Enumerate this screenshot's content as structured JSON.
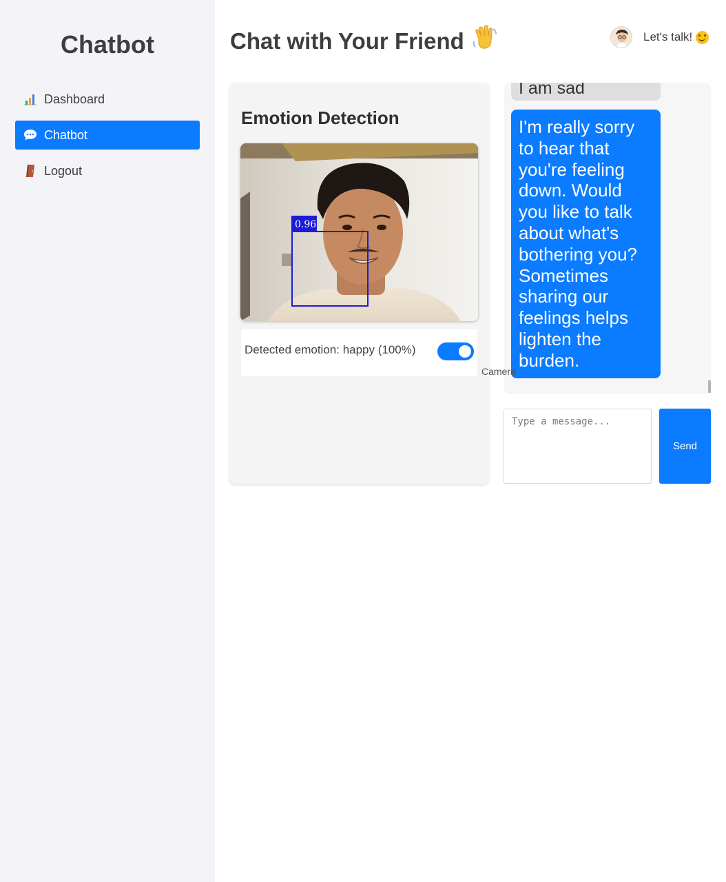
{
  "sidebar": {
    "brand": "Chatbot",
    "items": [
      {
        "label": "Dashboard",
        "icon": "bar-chart-icon"
      },
      {
        "label": "Chatbot",
        "icon": "speech-bubble-icon",
        "active": true
      },
      {
        "label": "Logout",
        "icon": "door-icon"
      }
    ]
  },
  "header": {
    "title": "Chat with Your Friend",
    "title_icon": "waving-hand-icon",
    "right_text": "Let's talk!",
    "right_icon": "smiling-face-icon",
    "avatar": "avatar-icon"
  },
  "emotion": {
    "title": "Emotion Detection",
    "face_confidence": "0.96",
    "detected_text": "Detected emotion: happy (100%)",
    "camera_toggle_on": true,
    "camera_label": "Camera"
  },
  "chat": {
    "messages": [
      {
        "role": "user",
        "text": "I am sad"
      },
      {
        "role": "bot",
        "text": "I'm really sorry to hear that you're feeling down. Would you like to talk about what's bothering you? Sometimes sharing our feelings helps lighten the burden."
      }
    ],
    "input_placeholder": "Type a message...",
    "send_label": "Send"
  },
  "colors": {
    "accent": "#0b7bff",
    "sidebar_bg": "#f3f3f8",
    "face_box": "#1c1cd6"
  }
}
